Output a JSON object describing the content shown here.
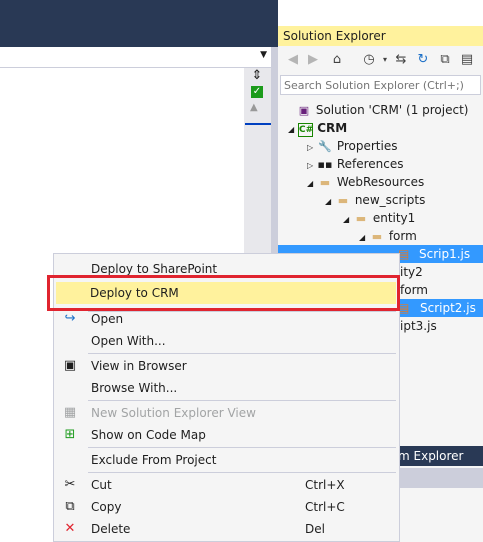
{
  "solution_explorer": {
    "title": "Solution Explorer",
    "search_placeholder": "Search Solution Explorer (Ctrl+;)",
    "toolbar_icons": [
      "back-icon",
      "forward-icon",
      "home-icon",
      "history-icon",
      "sync-icon",
      "refresh-icon",
      "collapse-all-icon",
      "show-all-files-icon"
    ],
    "tree": [
      {
        "label": "Solution 'CRM' (1 project)",
        "icon": "solution-icon"
      },
      {
        "label": "CRM",
        "icon": "csharp-project-icon"
      },
      {
        "label": "Properties",
        "icon": "wrench-icon"
      },
      {
        "label": "References",
        "icon": "references-icon"
      },
      {
        "label": "WebResources",
        "icon": "folder-icon"
      },
      {
        "label": "new_scripts",
        "icon": "folder-icon"
      },
      {
        "label": "entity1",
        "icon": "folder-icon"
      },
      {
        "label": "form",
        "icon": "folder-icon"
      },
      {
        "label": "Scrip1.js",
        "icon": "js-file-icon"
      },
      {
        "label": "ity2",
        "icon": ""
      },
      {
        "label": "form",
        "icon": ""
      },
      {
        "label": "Script2.js",
        "icon": "js-file-icon"
      },
      {
        "label": "ipt3.js",
        "icon": ""
      }
    ],
    "team_tab": "m Explorer"
  },
  "context_menu": {
    "items": [
      {
        "label": "Deploy to SharePoint",
        "shortcut": "",
        "icon": ""
      },
      {
        "label": "Deploy to CRM",
        "shortcut": "",
        "icon": ""
      },
      {
        "label": "Open",
        "shortcut": "",
        "icon": "open-arrow-icon"
      },
      {
        "label": "Open With...",
        "shortcut": "",
        "icon": ""
      },
      {
        "label": "View in Browser",
        "shortcut": "",
        "icon": "browser-icon"
      },
      {
        "label": "Browse With...",
        "shortcut": "",
        "icon": ""
      },
      {
        "label": "New Solution Explorer View",
        "shortcut": "",
        "icon": "new-view-icon"
      },
      {
        "label": "Show on Code Map",
        "shortcut": "",
        "icon": "code-map-icon"
      },
      {
        "label": "Exclude From Project",
        "shortcut": "",
        "icon": ""
      },
      {
        "label": "Cut",
        "shortcut": "Ctrl+X",
        "icon": "scissors-icon"
      },
      {
        "label": "Copy",
        "shortcut": "Ctrl+C",
        "icon": "copy-icon"
      },
      {
        "label": "Delete",
        "shortcut": "Del",
        "icon": "delete-x-icon"
      }
    ]
  },
  "colors": {
    "accent_yellow": "#fff29d",
    "selection_blue": "#3399ff",
    "highlight_red": "#e0242f",
    "vs_dark_blue": "#293955"
  }
}
